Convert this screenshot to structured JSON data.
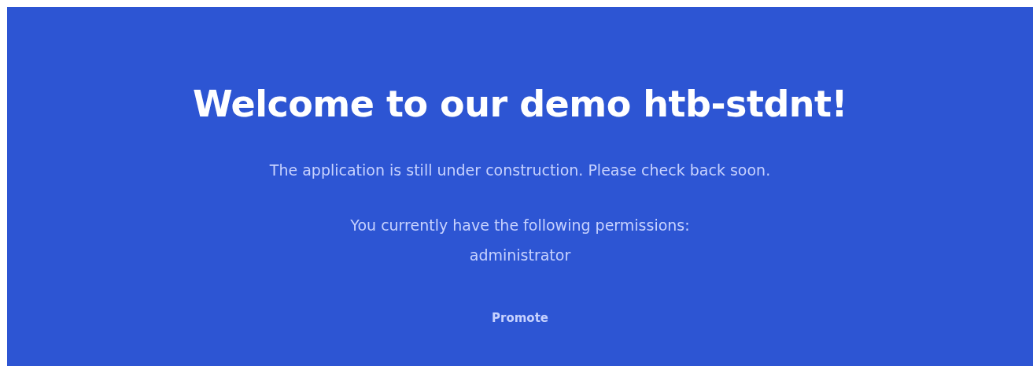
{
  "hero": {
    "title": "Welcome to our demo htb-stdnt!",
    "message": "The application is still under construction. Please check back soon.",
    "permissions_label": "You currently have the following permissions:",
    "permissions": [
      "administrator"
    ],
    "button": "Promote"
  }
}
